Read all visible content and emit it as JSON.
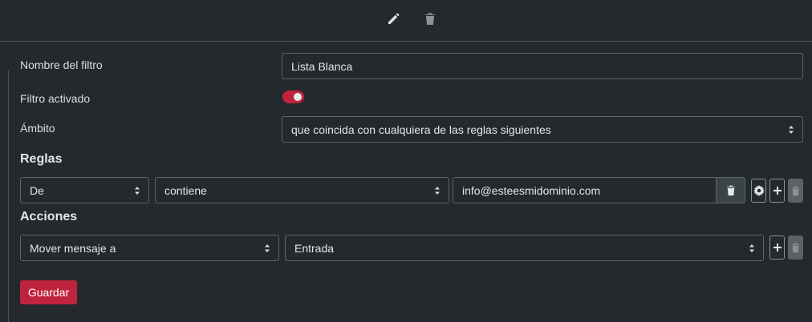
{
  "toolbar": {
    "edit_icon": "pencil-icon",
    "delete_icon": "trash-icon"
  },
  "form": {
    "name_label": "Nombre del filtro",
    "name_value": "Lista Blanca",
    "active_label": "Filtro activado",
    "active_value": true,
    "scope_label": "Ámbito",
    "scope_value": "que coincida con cualquiera de las reglas siguientes"
  },
  "rules": {
    "heading": "Reglas",
    "items": [
      {
        "field": "De",
        "operator": "contiene",
        "value": "info@esteesmidominio.com"
      }
    ]
  },
  "actions": {
    "heading": "Acciones",
    "items": [
      {
        "action": "Mover mensaje a",
        "target": "Entrada"
      }
    ]
  },
  "save_label": "Guardar",
  "colors": {
    "background": "#23292c",
    "accent": "#c0233e",
    "border": "#5c6569"
  }
}
